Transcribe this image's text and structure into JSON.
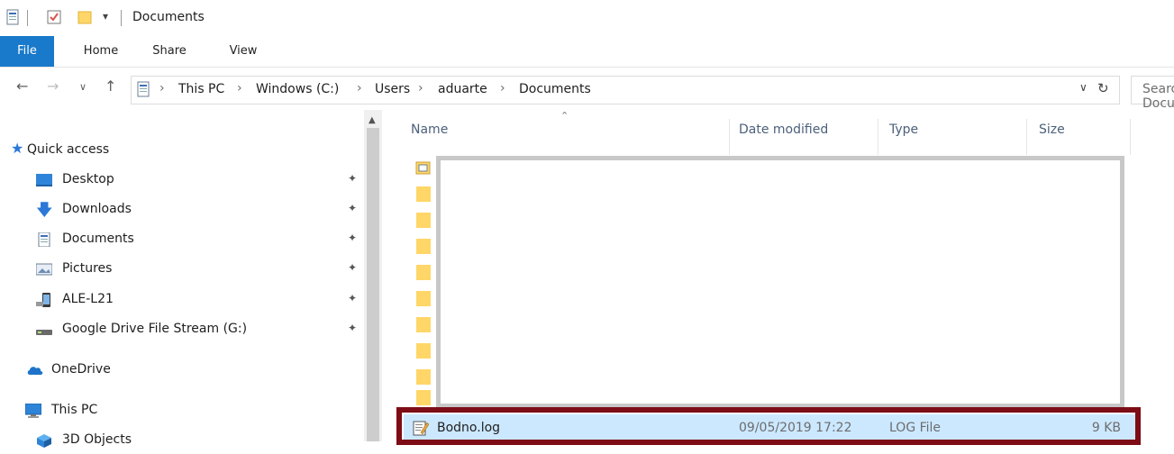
{
  "window": {
    "title": "Documents"
  },
  "ribbon": {
    "tabs": [
      "File",
      "Home",
      "Share",
      "View"
    ]
  },
  "address": {
    "breadcrumbs": [
      "This PC",
      "Windows (C:)",
      "Users",
      "aduarte",
      "Documents"
    ],
    "search_placeholder": "Search Documents"
  },
  "navpane": {
    "items": [
      {
        "label": "Quick access",
        "icon": "star-icon"
      },
      {
        "label": "Desktop",
        "icon": "desktop-icon",
        "pinned": true
      },
      {
        "label": "Downloads",
        "icon": "download-icon",
        "pinned": true
      },
      {
        "label": "Documents",
        "icon": "documents-icon",
        "pinned": true
      },
      {
        "label": "Pictures",
        "icon": "pictures-icon",
        "pinned": true
      },
      {
        "label": "ALE-L21",
        "icon": "phone-icon",
        "pinned": true
      },
      {
        "label": "Google Drive File Stream (G:)",
        "icon": "drive-icon",
        "pinned": true
      },
      {
        "label": "OneDrive",
        "icon": "cloud-icon"
      },
      {
        "label": "This PC",
        "icon": "computer-icon"
      },
      {
        "label": "3D Objects",
        "icon": "3d-objects-icon"
      }
    ]
  },
  "columns": [
    "Name",
    "Date modified",
    "Type",
    "Size"
  ],
  "files": [
    {
      "name": "Bodno.log",
      "date": "09/05/2019 17:22",
      "type": "LOG File",
      "size": "9 KB"
    }
  ],
  "colors": {
    "file_tab": "#1979ca",
    "selection": "#cce8ff",
    "highlight_border": "#7d0c16"
  }
}
